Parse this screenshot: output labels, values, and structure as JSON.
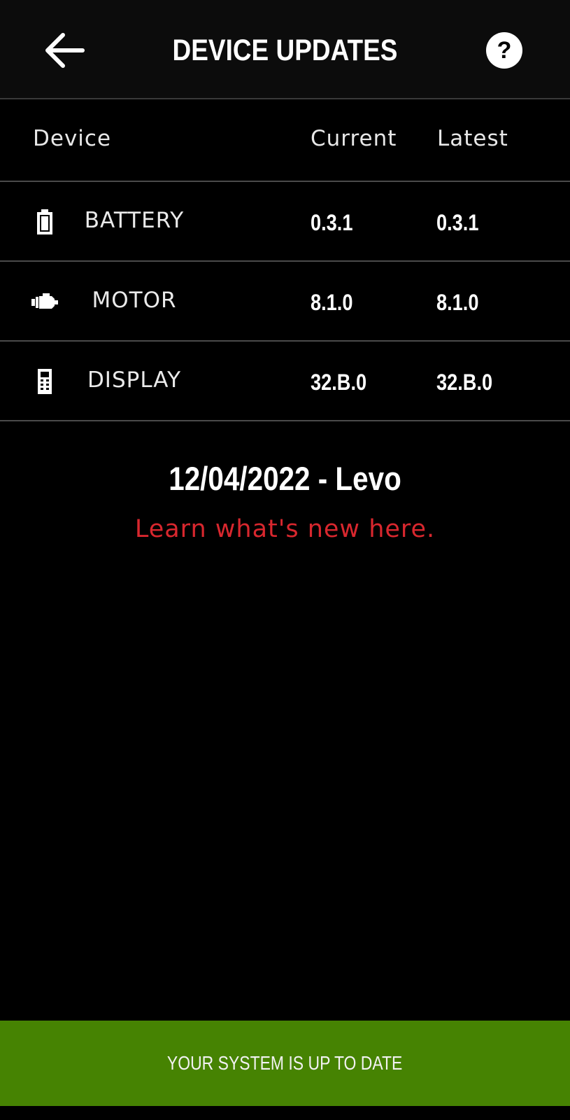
{
  "header": {
    "title": "DEVICE UPDATES",
    "help_label": "?"
  },
  "table": {
    "columns": [
      "Device",
      "Current",
      "Latest"
    ],
    "rows": [
      {
        "icon": "battery-icon",
        "name": "BATTERY",
        "current": "0.3.1",
        "latest": "0.3.1"
      },
      {
        "icon": "motor-icon",
        "name": "MOTOR",
        "current": "8.1.0",
        "latest": "8.1.0"
      },
      {
        "icon": "display-icon",
        "name": "DISPLAY",
        "current": "32.B.0",
        "latest": "32.B.0"
      }
    ]
  },
  "release": {
    "title": "12/04/2022  - Levo",
    "link": "Learn what's new here."
  },
  "status": {
    "text": "YOUR SYSTEM IS UP TO DATE",
    "color": "#468302"
  },
  "colors": {
    "link": "#d8272e",
    "background": "#000000"
  }
}
